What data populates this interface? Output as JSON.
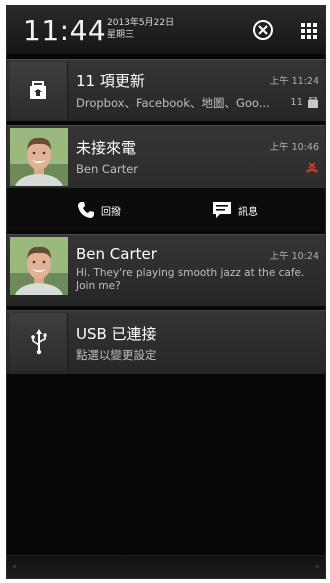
{
  "status": {
    "time": "11:44",
    "date": "2013年5月22日",
    "weekday": "星期三"
  },
  "notifications": [
    {
      "icon": "app-update-icon",
      "title": "11 項更新",
      "subtitle": "Dropbox、Facebook、地圖、Goo...",
      "time": "上午 11:24",
      "count": "11"
    },
    {
      "icon": "contact-photo",
      "title": "未接來電",
      "subtitle": "Ben Carter",
      "time": "上午 10:46",
      "status_icon": "missed-call-icon",
      "actions": [
        {
          "icon": "phone-icon",
          "label": "回撥"
        },
        {
          "icon": "message-icon",
          "label": "訊息"
        }
      ]
    },
    {
      "icon": "contact-photo",
      "title": "Ben Carter",
      "body": "Hi. They're playing smooth jazz at the cafe. Join me?",
      "time": "上午 10:24"
    },
    {
      "icon": "usb-icon",
      "title": "USB 已連接",
      "subtitle": "點選以變更設定"
    }
  ],
  "colors": {
    "background": "#070707",
    "card": "#303030",
    "missed": "#d23a2a",
    "text": "#ffffff",
    "secondary": "#bfbfbf"
  }
}
